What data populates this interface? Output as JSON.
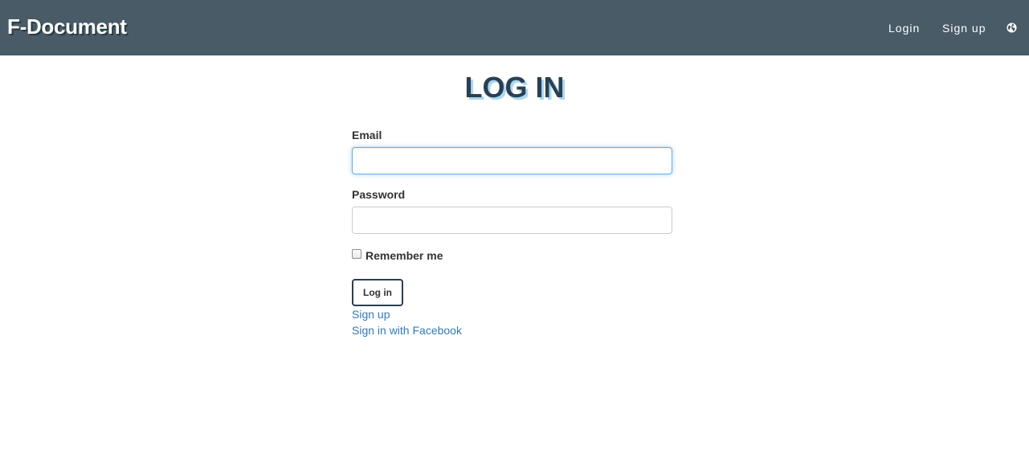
{
  "navbar": {
    "brand": "F-Document",
    "links": {
      "login": "Login",
      "signup": "Sign up"
    },
    "language_icon": "globe-icon",
    "background": "#485b66"
  },
  "page": {
    "title": "LOG IN"
  },
  "form": {
    "email_label": "Email",
    "email_value": "",
    "password_label": "Password",
    "password_value": "",
    "remember_label": "Remember me",
    "remember_checked": false,
    "submit_label": "Log in"
  },
  "links": {
    "signup": "Sign up",
    "facebook": "Sign in with Facebook"
  },
  "colors": {
    "accent": "#2b3f52",
    "title_shadow": "#a9d8f2",
    "link": "#337ab7",
    "focus": "#66afe9"
  }
}
